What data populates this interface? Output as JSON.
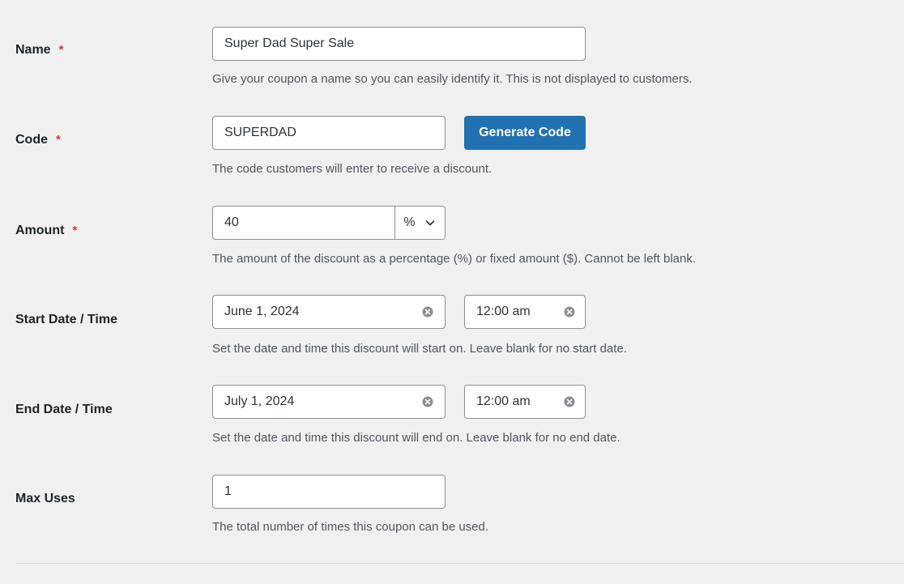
{
  "form": {
    "name": {
      "label": "Name",
      "required_mark": "*",
      "value": "Super Dad Super Sale",
      "description": "Give your coupon a name so you can easily identify it. This is not displayed to customers."
    },
    "code": {
      "label": "Code",
      "required_mark": "*",
      "value": "SUPERDAD",
      "button_label": "Generate Code",
      "description": "The code customers will enter to receive a discount."
    },
    "amount": {
      "label": "Amount",
      "required_mark": "*",
      "value": "40",
      "type_selected": "%",
      "description": "The amount of the discount as a percentage (%) or fixed amount ($). Cannot be left blank."
    },
    "start": {
      "label": "Start Date / Time",
      "date_value": "June 1, 2024",
      "time_value": "12:00 am",
      "description": "Set the date and time this discount will start on. Leave blank for no start date."
    },
    "end": {
      "label": "End Date / Time",
      "date_value": "July 1, 2024",
      "time_value": "12:00 am",
      "description": "Set the date and time this discount will end on. Leave blank for no end date."
    },
    "max_uses": {
      "label": "Max Uses",
      "value": "1",
      "description": "The total number of times this coupon can be used."
    }
  },
  "colors": {
    "background": "#f0f0f1",
    "primary_button": "#2271b1",
    "required": "#d63638",
    "description_text": "#50575e"
  },
  "icons": {
    "clear": "clear-circle-icon",
    "dropdown": "chevron-down-icon"
  }
}
